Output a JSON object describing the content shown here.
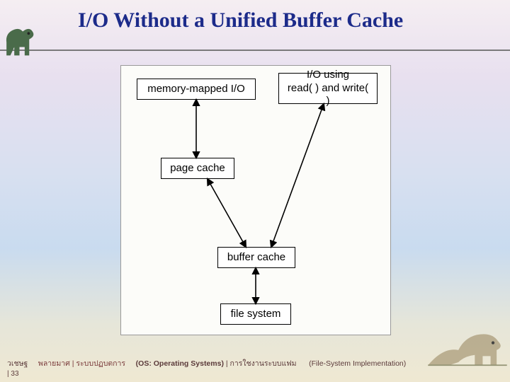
{
  "title": "I/O Without a Unified Buffer Cache",
  "nodes": {
    "mmio": "memory-mapped I/O",
    "rwio": "I/O using\nread( ) and write( )",
    "pcache": "page cache",
    "bcache": "buffer cache",
    "fs": "file system"
  },
  "footer": {
    "left1": "วเชษฐ",
    "page": "| 33",
    "left2": "พลายมาศ | ระบบปฏบตการ",
    "mid": "(OS: Operating Systems)",
    "mid2": " | การใชงานระบบแฟม",
    "right": "(File-System Implementation)"
  }
}
